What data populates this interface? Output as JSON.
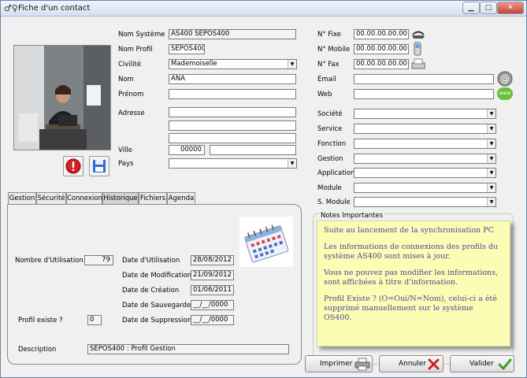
{
  "window": {
    "title": "Fiche d'un contact"
  },
  "identity": {
    "nom_systeme_label": "Nom Système",
    "nom_systeme_value": "AS400 SEPOS400",
    "nom_profil_label": "Nom Profil",
    "nom_profil_value": "SEPOS400",
    "civilite_label": "Civilité",
    "civilite_value": "Mademoiselle",
    "nom_label": "Nom",
    "nom_value": "ANA",
    "prenom_label": "Prénom",
    "prenom_value": "",
    "adresse_label": "Adresse",
    "ville_label": "Ville",
    "cp_value": "00000",
    "ville_value": "",
    "pays_label": "Pays",
    "pays_value": ""
  },
  "contact": {
    "fixe_label": "N° Fixe",
    "fixe_value": "00.00.00.00.00",
    "mobile_label": "N° Mobile",
    "mobile_value": "00.00.00.00.00",
    "fax_label": "N° Fax",
    "fax_value": "00.00.00.00.00",
    "email_label": "Email",
    "web_label": "Web",
    "web_badge": "www"
  },
  "org": {
    "societe": "Société",
    "service": "Service",
    "fonction": "Fonction",
    "gestion": "Gestion",
    "application": "Application",
    "module": "Module",
    "smodule": "S. Module"
  },
  "tabs": [
    "Gestion",
    "Sécurité",
    "Connexion",
    "Historique",
    "Fichiers",
    "Agenda"
  ],
  "historique": {
    "nb_util_label": "Nombre d'Utilisation",
    "nb_util_value": "79",
    "date_util_label": "Date d'Utilisation",
    "date_util_value": "28/08/2012",
    "date_modif_label": "Date de Modification",
    "date_modif_value": "21/09/2012",
    "date_crea_label": "Date de Création",
    "date_crea_value": "01/06/2011",
    "date_sauv_label": "Date de Sauvegarde",
    "date_sauv_value": "__/__/0000",
    "profil_existe_label": "Profil existe ?",
    "profil_existe_value": "0",
    "date_supp_label": "Date de Suppression",
    "date_supp_value": "__/__/0000",
    "description_label": "Description",
    "description_value": "SEPOS400 : Profil Gestion"
  },
  "notes": {
    "label": "Notes Importantes",
    "p1": "Suite au lancement de la synchronisation PC",
    "p2": "Les informations de connexions des profils du système AS400 sont mises à jour.",
    "p3": "Vous ne pouvez pas modifier les informations, sont affichées à titre d'information.",
    "p4": "Profil Existe ? (O=Oui/N=Nom), celui-ci a été supprimé manuellement sur le système OS400."
  },
  "buttons": {
    "imprimer": "Imprimer",
    "annuler": "Annuler",
    "valider": "Valider"
  }
}
